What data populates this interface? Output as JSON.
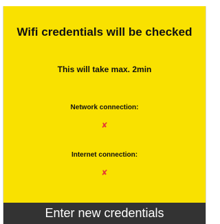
{
  "dialog": {
    "title": "Wifi credentials will be checked",
    "subtitle": "This will take max. 2min",
    "network": {
      "label": "Network connection:",
      "status": "✘",
      "status_icon": "red-cross-icon"
    },
    "internet": {
      "label": "Internet connection:",
      "status": "✘",
      "status_icon": "red-cross-icon"
    },
    "button_label": "Enter new credentials"
  },
  "colors": {
    "panel_background": "#f9e100",
    "button_background": "#333333",
    "button_text": "#ffffff",
    "status_fail": "#e53935",
    "text": "#111111"
  }
}
